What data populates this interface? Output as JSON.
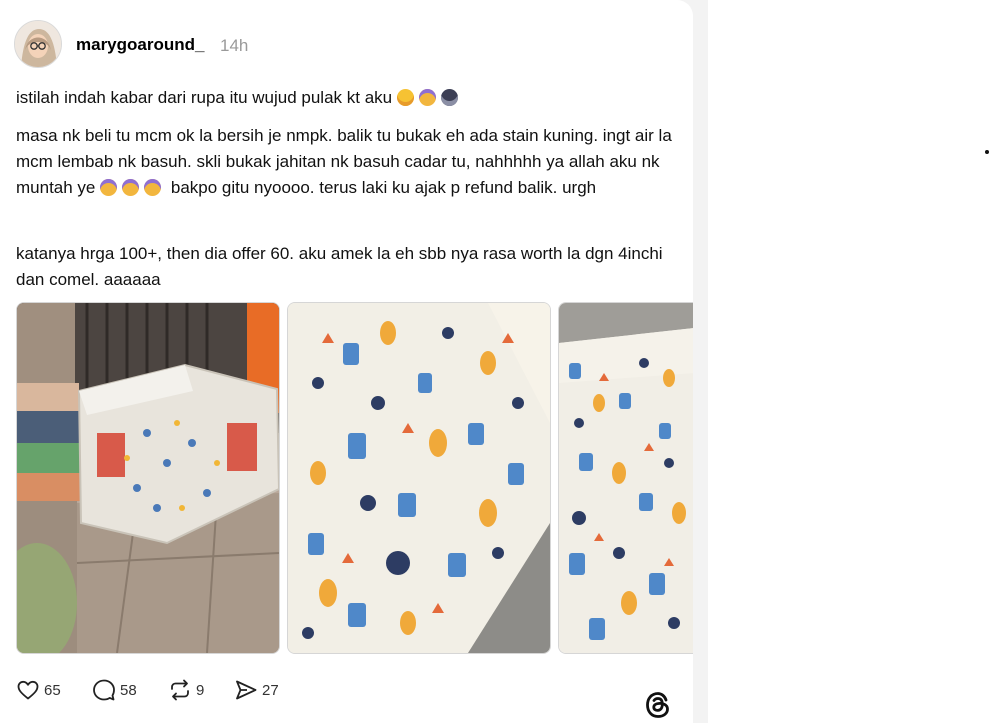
{
  "post": {
    "username": "marygoaround_",
    "time": "14h",
    "paragraph1": "istilah indah kabar dari rupa itu wujud pulak kt aku",
    "paragraph1_emojis": [
      "rolling-laughing-emoji",
      "screaming-face-emoji",
      "ninja-emoji"
    ],
    "paragraph2_part1": "masa nk beli tu mcm ok la bersih je nmpk. balik tu bukak eh ada stain kuning. ingt air la mcm lembab nk basuh. skli bukak jahitan nk basuh cadar tu, nahhhhh ya allah aku nk muntah ye",
    "paragraph2_emojis": [
      "screaming-face-emoji",
      "screaming-face-emoji",
      "screaming-face-emoji"
    ],
    "paragraph2_part2": "bakpo gitu nyoooo. terus laki ku ajak p refund balik. urgh",
    "paragraph3": "katanya hrga 100+, then dia offer 60. aku amek la eh sbb nya rasa worth la dgn 4inchi dan comel. aaaaaa"
  },
  "actions": {
    "likes": "65",
    "replies": "58",
    "reposts": "9",
    "shares": "27"
  },
  "icons": {
    "like": "heart-icon",
    "reply": "comment-bubble-icon",
    "repost": "repost-icon",
    "share": "send-icon",
    "logo": "threads-logo-icon"
  },
  "colors": {
    "text": "#111111",
    "muted": "#9a9a9a",
    "background_left": "#f3f3f3"
  }
}
